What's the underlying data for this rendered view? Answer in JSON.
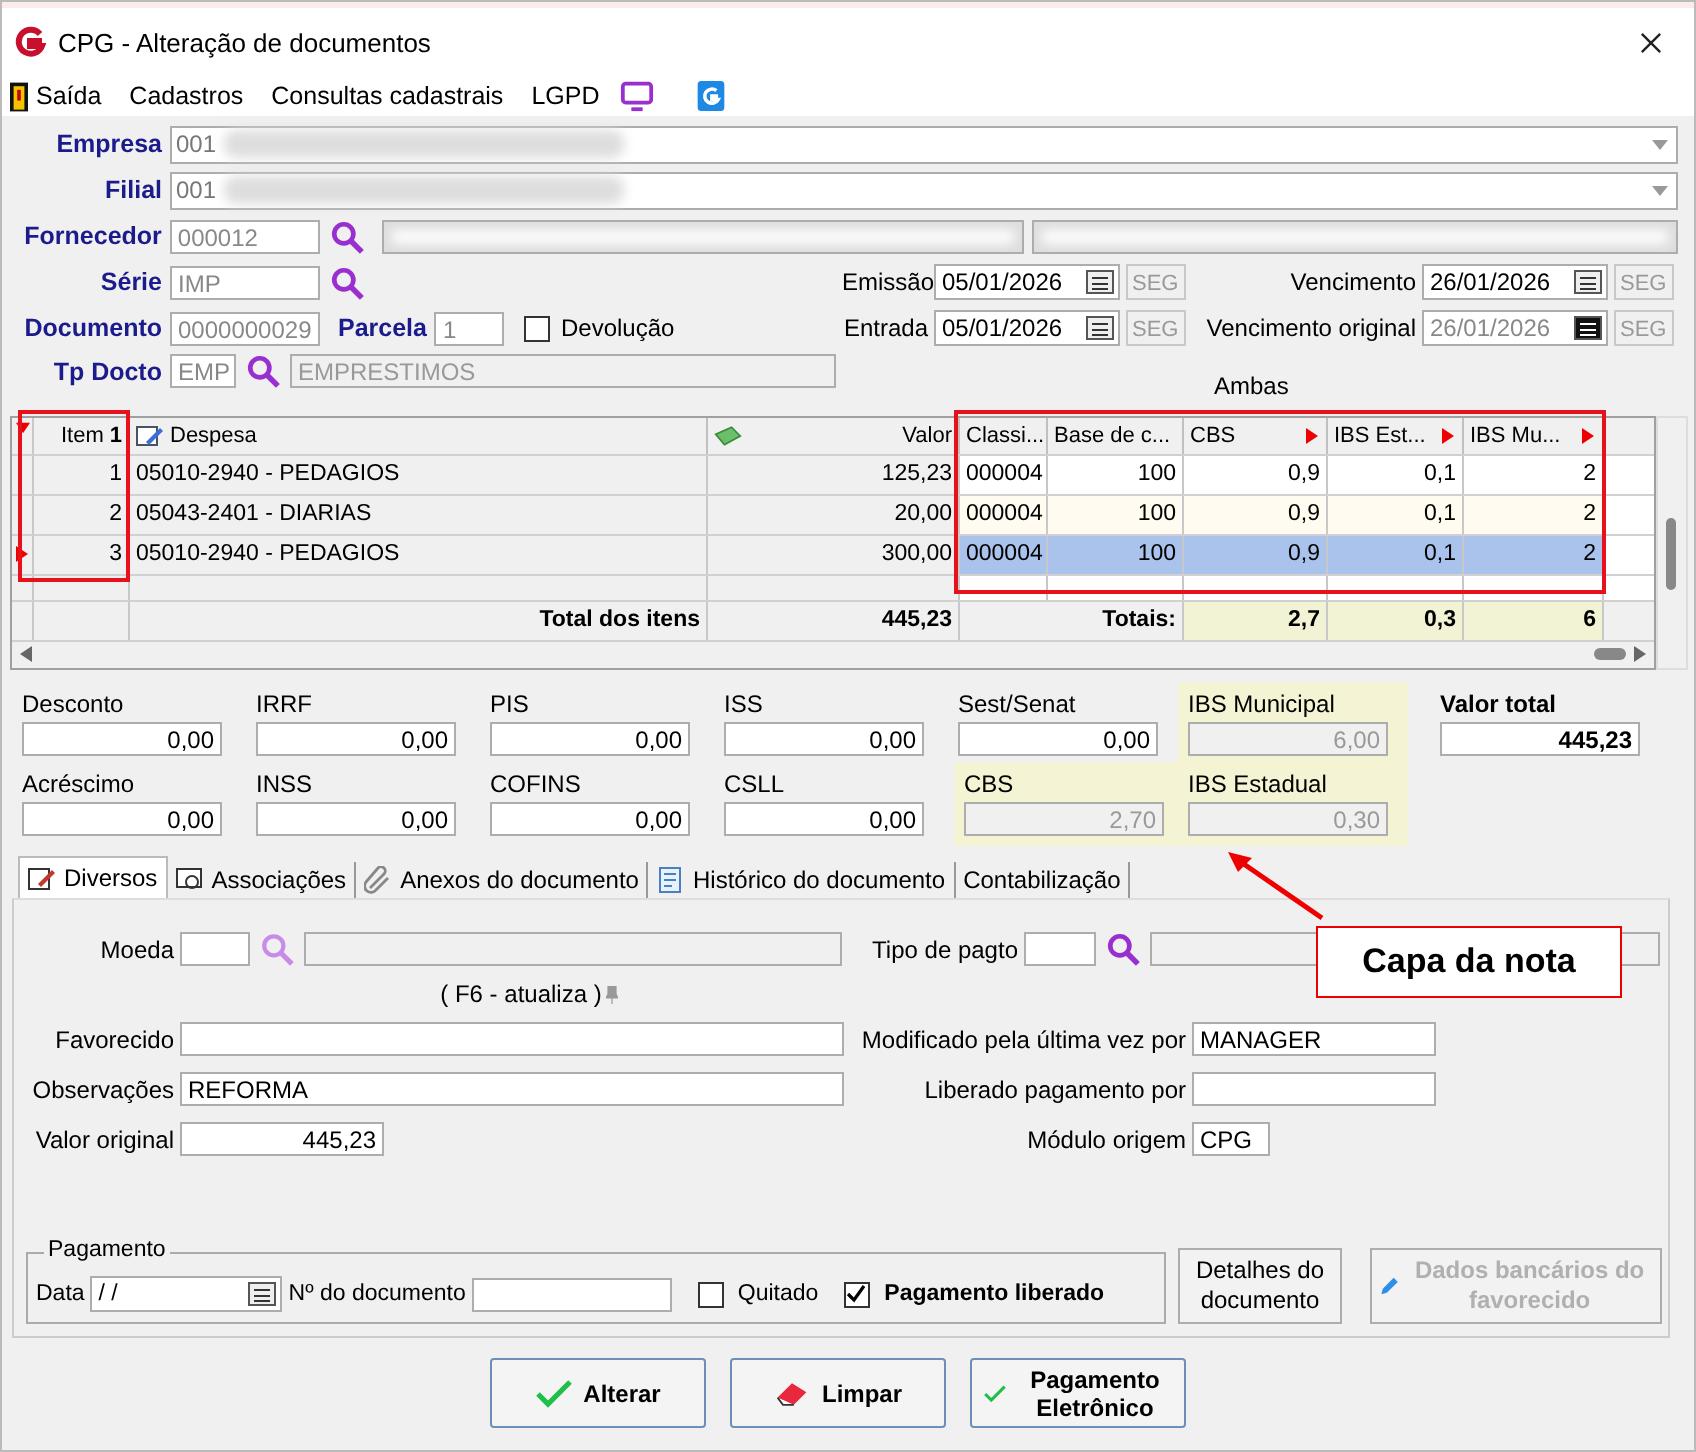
{
  "window": {
    "title": "CPG - Alteração de documentos"
  },
  "menu": [
    {
      "kind": "exit",
      "label": "Saída"
    },
    {
      "kind": "item",
      "label": "Cadastros"
    },
    {
      "kind": "item",
      "label": "Consultas cadastrais"
    },
    {
      "kind": "item",
      "label": "LGPD"
    },
    {
      "kind": "monitor"
    },
    {
      "kind": "logo"
    }
  ],
  "empresa": {
    "label": "Empresa",
    "value": "001"
  },
  "filial": {
    "label": "Filial",
    "value": "001"
  },
  "fornecedor": {
    "label": "Fornecedor",
    "value": "000012"
  },
  "serie": {
    "label": "Série",
    "value": "IMP"
  },
  "documento": {
    "label": "Documento",
    "value": "0000000029"
  },
  "parcela": {
    "label": "Parcela",
    "value": "1"
  },
  "devolucao": {
    "label": "Devolução",
    "checked": false
  },
  "tp_docto": {
    "label": "Tp Docto",
    "value": "EMP",
    "description": "EMPRESTIMOS"
  },
  "dates": [
    {
      "label": "Emissão",
      "value": "05/01/2026",
      "day": "SEG",
      "disabled": false
    },
    {
      "label": "Vencimento",
      "value": "26/01/2026",
      "day": "SEG",
      "disabled": false
    },
    {
      "label": "Entrada",
      "value": "05/01/2026",
      "day": "SEG",
      "disabled": false
    },
    {
      "label": "Vencimento original",
      "value": "26/01/2026",
      "day": "SEG",
      "disabled": true
    }
  ],
  "mode_label": "Ambas",
  "grid": {
    "columns": [
      {
        "label": "Item",
        "sort_order": "1",
        "flag": false
      },
      {
        "label": "Despesa",
        "flag": false
      },
      {
        "label": "Valor",
        "flag": false
      },
      {
        "label": "Classi...",
        "flag": false
      },
      {
        "label": "Base de c...",
        "flag": false
      },
      {
        "label": "CBS",
        "flag": true
      },
      {
        "label": "IBS Est...",
        "flag": true
      },
      {
        "label": "IBS Mu...",
        "flag": true
      }
    ],
    "rows": [
      {
        "cells": [
          "1",
          "05010-2940 - PEDAGIOS",
          "125,23",
          "000004",
          "100",
          "0,9",
          "0,1",
          "2"
        ],
        "selected": false
      },
      {
        "cells": [
          "2",
          "05043-2401 - DIARIAS",
          "20,00",
          "000004",
          "100",
          "0,9",
          "0,1",
          "2"
        ],
        "selected": false
      },
      {
        "cells": [
          "3",
          "05010-2940 - PEDAGIOS",
          "300,00",
          "000004",
          "100",
          "0,9",
          "0,1",
          "2"
        ],
        "selected": true
      }
    ],
    "total_label": "Total dos itens",
    "total_value": "445,23",
    "totals_label": "Totais:",
    "totals": [
      "2,7",
      "0,3",
      "6"
    ]
  },
  "taxes": [
    [
      {
        "label": "Desconto",
        "value": "0,00"
      },
      {
        "label": "IRRF",
        "value": "0,00"
      },
      {
        "label": "PIS",
        "value": "0,00"
      },
      {
        "label": "ISS",
        "value": "0,00"
      },
      {
        "label": "Sest/Senat",
        "value": "0,00"
      },
      {
        "label": "IBS Municipal",
        "value": "6,00",
        "kind": "reform"
      }
    ],
    [
      {
        "label": "Acréscimo",
        "value": "0,00"
      },
      {
        "label": "INSS",
        "value": "0,00"
      },
      {
        "label": "COFINS",
        "value": "0,00"
      },
      {
        "label": "CSLL",
        "value": "0,00"
      },
      {
        "label": "CBS",
        "value": "2,70",
        "kind": "reform"
      },
      {
        "label": "IBS Estadual",
        "value": "0,30",
        "kind": "reform"
      }
    ]
  ],
  "valor_total": {
    "label": "Valor total",
    "value": "445,23"
  },
  "tabs": [
    {
      "label": "Diversos",
      "selected": true
    },
    {
      "label": "Associações",
      "selected": false
    },
    {
      "label": "Anexos do documento",
      "selected": false
    },
    {
      "label": "Histórico do documento",
      "selected": false
    },
    {
      "label": "Contabilização",
      "selected": false
    }
  ],
  "diversos": {
    "moeda": "Moeda",
    "tipo_pagto": "Tipo de pagto",
    "hint": "( F6 - atualiza )",
    "favorecido": {
      "label": "Favorecido"
    },
    "observacoes": {
      "label": "Observações",
      "value": "REFORMA"
    },
    "valor_original": {
      "label": "Valor original",
      "value": "445,23"
    },
    "modificado": {
      "label": "Modificado pela última vez por",
      "value": "MANAGER"
    },
    "liberado": {
      "label": "Liberado pagamento por"
    },
    "modulo": {
      "label": "Módulo origem",
      "value": "CPG"
    }
  },
  "pagamento": {
    "title": "Pagamento",
    "data_label": "Data",
    "data_value": "/ /",
    "doc_label": "Nº do documento",
    "quitado": {
      "label": "Quitado",
      "checked": false
    },
    "liberado": {
      "label": "Pagamento liberado",
      "checked": true
    }
  },
  "side_buttons": [
    {
      "label": "Detalhes do documento",
      "disabled": false
    },
    {
      "label": "Dados bancários do favorecido",
      "disabled": true
    }
  ],
  "footer_buttons": [
    {
      "label": "Alterar"
    },
    {
      "label": "Limpar"
    },
    {
      "label": "Pagamento Eletrônico"
    }
  ],
  "annotation": {
    "label": "Capa da nota"
  }
}
